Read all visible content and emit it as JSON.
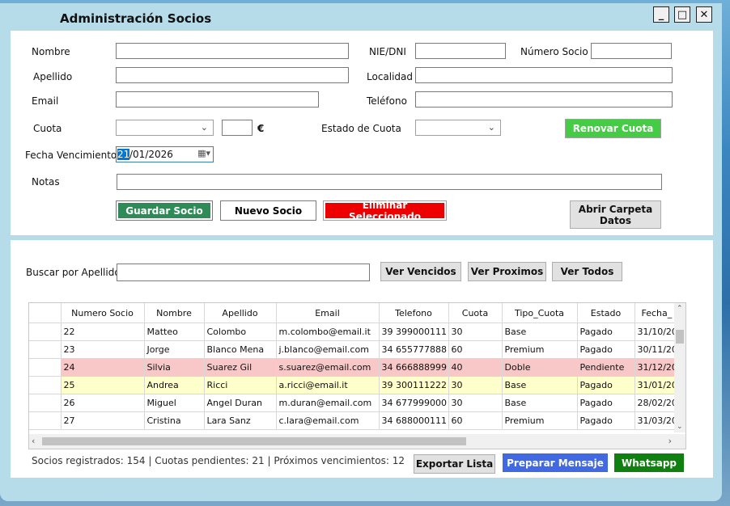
{
  "window": {
    "title": "Administración Socios"
  },
  "winbuttons": {
    "minimize": "_",
    "maximize": "□",
    "close": "✕"
  },
  "form": {
    "nombre_label": "Nombre",
    "nie_label": "NIE/DNI",
    "numero_label": "Número Socio",
    "apellido_label": "Apellido",
    "localidad_label": "Localidad",
    "email_label": "Email",
    "telefono_label": "Teléfono",
    "cuota_label": "Cuota",
    "euro": "€",
    "estado_label": "Estado de Cuota",
    "renovar": "Renovar Cuota",
    "fecha_label": "Fecha Vencimiento",
    "fecha_day": "21",
    "fecha_rest": "/01/2026",
    "notas_label": "Notas",
    "guardar": "Guardar Socio",
    "nuevo": "Nuevo Socio",
    "eliminar": "Eliminar Seleccionado",
    "abrir": "Abrir Carpeta\nDatos"
  },
  "search": {
    "label": "Buscar por Apellido:",
    "vencidos": "Ver Vencidos",
    "proximos": "Ver Proximos",
    "todos": "Ver Todos"
  },
  "grid": {
    "columns": [
      "Numero Socio",
      "Nombre",
      "Apellido",
      "Email",
      "Telefono",
      "Cuota",
      "Tipo_Cuota",
      "Estado",
      "Fecha_"
    ],
    "rows": [
      {
        "cells": [
          "22",
          "Matteo",
          "Colombo",
          "m.colombo@email.it",
          "39 399000111",
          "30",
          "Base",
          "Pagado",
          "31/10/20"
        ],
        "bg": "#ffffff"
      },
      {
        "cells": [
          "23",
          "Jorge",
          "Blanco Mena",
          "j.blanco@email.com",
          "34 655777888",
          "60",
          "Premium",
          "Pagado",
          "30/11/20"
        ],
        "bg": "#ffffff"
      },
      {
        "cells": [
          "24",
          "Silvia",
          "Suarez Gil",
          "s.suarez@email.com",
          "34 666888999",
          "40",
          "Doble",
          "Pendiente",
          "31/12/20"
        ],
        "bg": "#f8c8c8"
      },
      {
        "cells": [
          "25",
          "Andrea",
          "Ricci",
          "a.ricci@email.it",
          "39 300111222",
          "30",
          "Base",
          "Pagado",
          "31/01/20"
        ],
        "bg": "#ffffcc"
      },
      {
        "cells": [
          "26",
          "Miguel",
          "Angel Duran",
          "m.duran@email.com",
          "34 677999000",
          "30",
          "Base",
          "Pagado",
          "28/02/20"
        ],
        "bg": "#ffffff"
      },
      {
        "cells": [
          "27",
          "Cristina",
          "Lara Sanz",
          "c.lara@email.com",
          "34 688000111",
          "60",
          "Premium",
          "Pagado",
          "31/03/20"
        ],
        "bg": "#ffffff"
      }
    ]
  },
  "footer": {
    "status": "Socios registrados: 154 | Cuotas pendientes: 21 | Próximos vencimientos: 12",
    "exportar": "Exportar Lista",
    "mensaje": "Preparar Mensaje",
    "whatsapp": "Whatsapp"
  },
  "colors": {
    "guardar": "#2e8b57",
    "eliminar": "#ee0000",
    "renovar": "#44cc44",
    "mensaje": "#4169e1",
    "whatsapp": "#108010"
  }
}
